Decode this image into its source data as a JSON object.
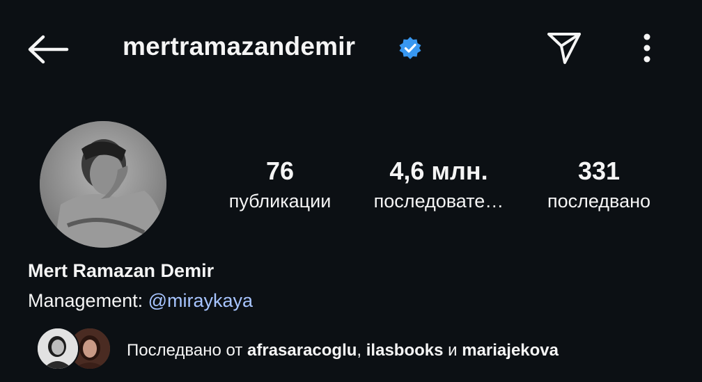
{
  "header": {
    "username": "mertramazandemir",
    "back_icon": "arrow-left-icon",
    "verified_icon": "verified-badge-icon",
    "verified_color": "#3897f0",
    "dm_icon": "paper-plane-icon",
    "more_icon": "more-vertical-icon"
  },
  "profile": {
    "avatar_icon": "profile-photo",
    "stats": [
      {
        "value": "76",
        "label": "публикации"
      },
      {
        "value": "4,6 млн.",
        "label": "последовате…"
      },
      {
        "value": "331",
        "label": "последвано"
      }
    ],
    "full_name": "Mert Ramazan Demir",
    "bio_prefix": "Management: ",
    "bio_mention": "@miraykaya",
    "mention_color": "#a7c4ff"
  },
  "followed_by": {
    "prefix": "Последвано от ",
    "users": [
      "afrasaracoglu",
      "ilasbooks",
      "mariajekova"
    ],
    "sep1": ", ",
    "sep2": " и "
  }
}
